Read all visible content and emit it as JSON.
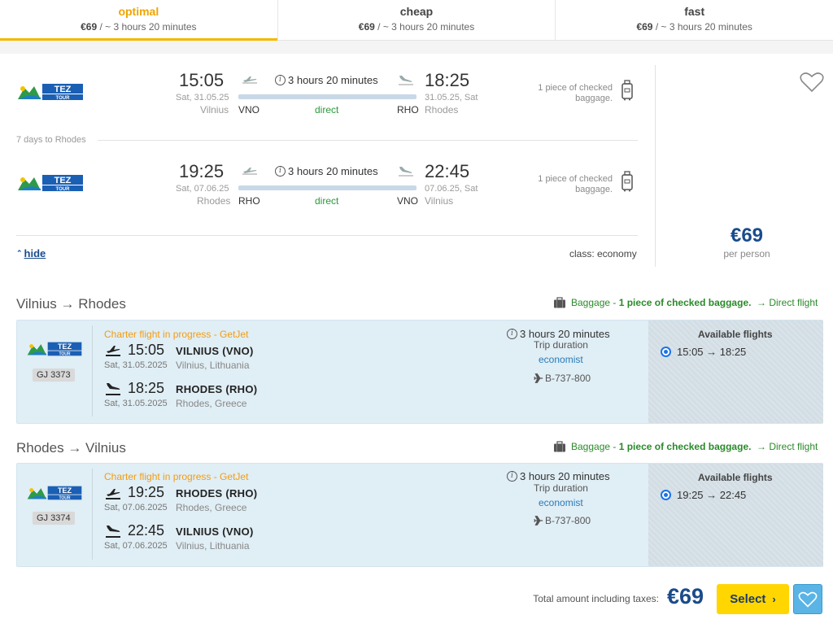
{
  "tabs": [
    {
      "title": "optimal",
      "price": "€69",
      "summary": " / ~ 3 hours 20 minutes"
    },
    {
      "title": "cheap",
      "price": "€69",
      "summary": " / ~ 3 hours 20 minutes"
    },
    {
      "title": "fast",
      "price": "€69",
      "summary": " / ~ 3 hours 20 minutes"
    }
  ],
  "offer": {
    "outbound": {
      "dep_time": "15:05",
      "dep_date": "Sat, 31.05.25",
      "dep_city": "Vilnius",
      "dep_code": "VNO",
      "duration": "3 hours 20 minutes",
      "stops": "direct",
      "arr_time": "18:25",
      "arr_date": "31.05.25, Sat",
      "arr_city": "Rhodes",
      "arr_code": "RHO",
      "baggage": "1 piece of checked baggage."
    },
    "stay": "7 days to Rhodes",
    "inbound": {
      "dep_time": "19:25",
      "dep_date": "Sat, 07.06.25",
      "dep_city": "Rhodes",
      "dep_code": "RHO",
      "duration": "3 hours 20 minutes",
      "stops": "direct",
      "arr_time": "22:45",
      "arr_date": "07.06.25, Sat",
      "arr_city": "Vilnius",
      "arr_code": "VNO",
      "baggage": "1 piece of checked baggage."
    },
    "hide_label": "hide",
    "class_label": "class: economy",
    "price": "€69",
    "per_person": "per person"
  },
  "segments": [
    {
      "title": "Vilnius → Rhodes",
      "baggage_prefix": "Baggage - ",
      "baggage_bold": "1 piece of checked baggage.",
      "direct": "→ Direct flight",
      "flight_no": "GJ 3373",
      "charter": "Charter flight in progress - GetJet",
      "dep_time": "15:05",
      "dep_airport": "VILNIUS (VNO)",
      "dep_date": "Sat, 31.05.2025",
      "dep_loc": "Vilnius, Lithuania",
      "arr_time": "18:25",
      "arr_airport": "RHODES (RHO)",
      "arr_date": "Sat, 31.05.2025",
      "arr_loc": "Rhodes, Greece",
      "duration": "3 hours 20 minutes",
      "duration_label": "Trip duration",
      "fare": "economist",
      "aircraft": "B-737-800",
      "avail_title": "Available flights",
      "avail_option": "15:05 → 18:25"
    },
    {
      "title": "Rhodes → Vilnius",
      "baggage_prefix": "Baggage - ",
      "baggage_bold": "1 piece of checked baggage.",
      "direct": "→ Direct flight",
      "flight_no": "GJ 3374",
      "charter": "Charter flight in progress - GetJet",
      "dep_time": "19:25",
      "dep_airport": "RHODES (RHO)",
      "dep_date": "Sat, 07.06.2025",
      "dep_loc": "Rhodes, Greece",
      "arr_time": "22:45",
      "arr_airport": "VILNIUS (VNO)",
      "arr_date": "Sat, 07.06.2025",
      "arr_loc": "Vilnius, Lithuania",
      "duration": "3 hours 20 minutes",
      "duration_label": "Trip duration",
      "fare": "economist",
      "aircraft": "B-737-800",
      "avail_title": "Available flights",
      "avail_option": "19:25 → 22:45"
    }
  ],
  "footer": {
    "total_label": "Total amount including taxes:",
    "total": "€69",
    "select": "Select"
  },
  "airline_logo": {
    "top": "TEZ",
    "bottom": "TOUR"
  },
  "icons": [
    "takeoff-icon",
    "landing-icon",
    "info-icon",
    "suitcase-icon",
    "heart-icon",
    "plane-icon",
    "briefcase-icon",
    "chevron-up-icon",
    "chevron-right-icon"
  ],
  "colors": {
    "accent": "#f5b800",
    "price": "#1a4b8c",
    "direct": "#2a9a3a",
    "charter": "#f39c12",
    "link": "#1a73e8"
  }
}
